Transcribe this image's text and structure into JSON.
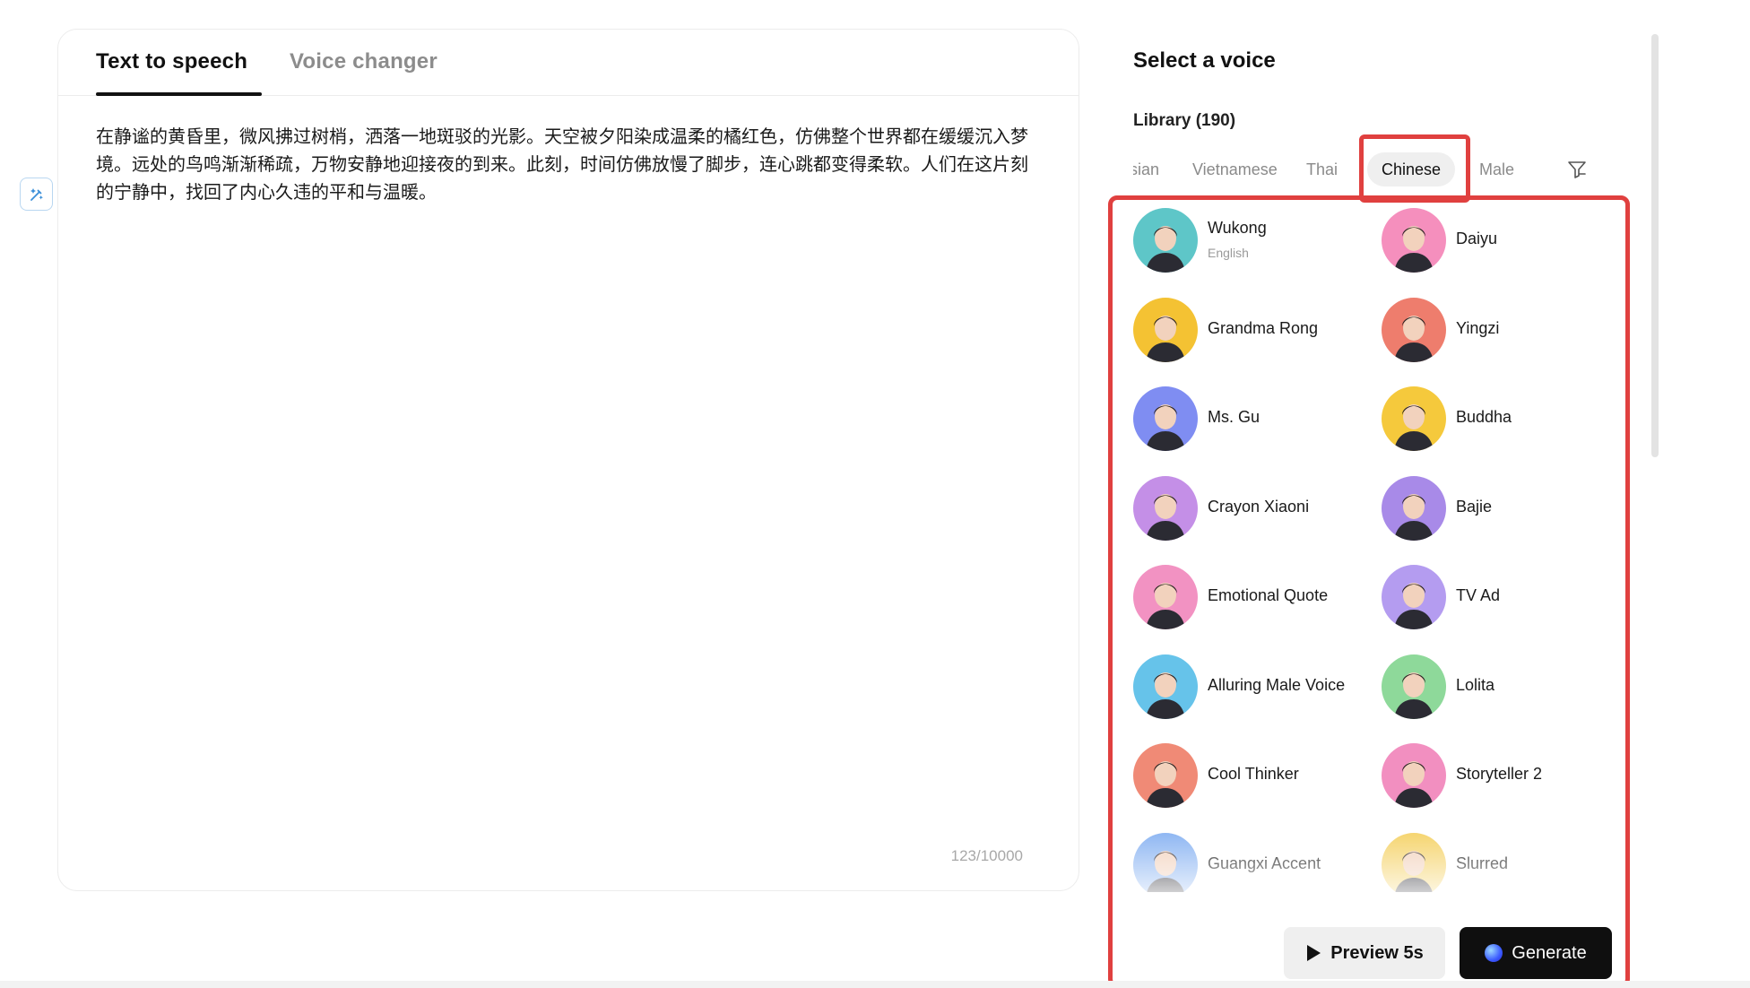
{
  "editor": {
    "tabs": [
      {
        "label": "Text to speech",
        "active": true
      },
      {
        "label": "Voice changer",
        "active": false
      }
    ],
    "text": "在静谧的黄昏里，微风拂过树梢，洒落一地斑驳的光影。天空被夕阳染成温柔的橘红色，仿佛整个世界都在缓缓沉入梦境。远处的鸟鸣渐渐稀疏，万物安静地迎接夜的到来。此刻，时间仿佛放慢了脚步，连心跳都变得柔软。人们在这片刻的宁静中，找回了内心久违的平和与温暖。",
    "char_count": "123/10000"
  },
  "voice_panel": {
    "title": "Select a voice",
    "library_label": "Library (190)",
    "filters": [
      {
        "label": "sian",
        "active": false
      },
      {
        "label": "Vietnamese",
        "active": false
      },
      {
        "label": "Thai",
        "active": false
      },
      {
        "label": "Chinese",
        "active": true
      },
      {
        "label": "Male",
        "active": false
      }
    ],
    "voices": [
      {
        "name": "Wukong",
        "sub": "English",
        "color": "#5ec6c8"
      },
      {
        "name": "Daiyu",
        "sub": "",
        "color": "#f58fbd"
      },
      {
        "name": "Grandma Rong",
        "sub": "",
        "color": "#f4c233"
      },
      {
        "name": "Yingzi",
        "sub": "",
        "color": "#ee7d6d"
      },
      {
        "name": "Ms. Gu",
        "sub": "",
        "color": "#7f8df2"
      },
      {
        "name": "Buddha",
        "sub": "",
        "color": "#f5c93c"
      },
      {
        "name": "Crayon Xiaoni",
        "sub": "",
        "color": "#c48fe7"
      },
      {
        "name": "Bajie",
        "sub": "",
        "color": "#a88ae8"
      },
      {
        "name": "Emotional Quote",
        "sub": "",
        "color": "#f292c2"
      },
      {
        "name": "TV Ad",
        "sub": "",
        "color": "#b49cf0"
      },
      {
        "name": "Alluring Male Voice",
        "sub": "",
        "color": "#66c3ea"
      },
      {
        "name": "Lolita",
        "sub": "",
        "color": "#8ed99a"
      },
      {
        "name": "Cool Thinker",
        "sub": "",
        "color": "#f08a76"
      },
      {
        "name": "Storyteller 2",
        "sub": "",
        "color": "#f28fc0"
      },
      {
        "name": "Guangxi Accent",
        "sub": "",
        "color": "#8ab4f2"
      },
      {
        "name": "Slurred",
        "sub": "",
        "color": "#f5d36a"
      }
    ],
    "preview_label": "Preview 5s",
    "generate_label": "Generate"
  },
  "colors": {
    "highlight": "#e0403f",
    "tool_border": "#b9d7f1",
    "tool_icon": "#3a8ed8"
  },
  "icons": {
    "side_tool": "magic-edit-icon",
    "filter": "filter-funnel-icon",
    "preview": "play-icon",
    "generate": "orb-icon"
  }
}
